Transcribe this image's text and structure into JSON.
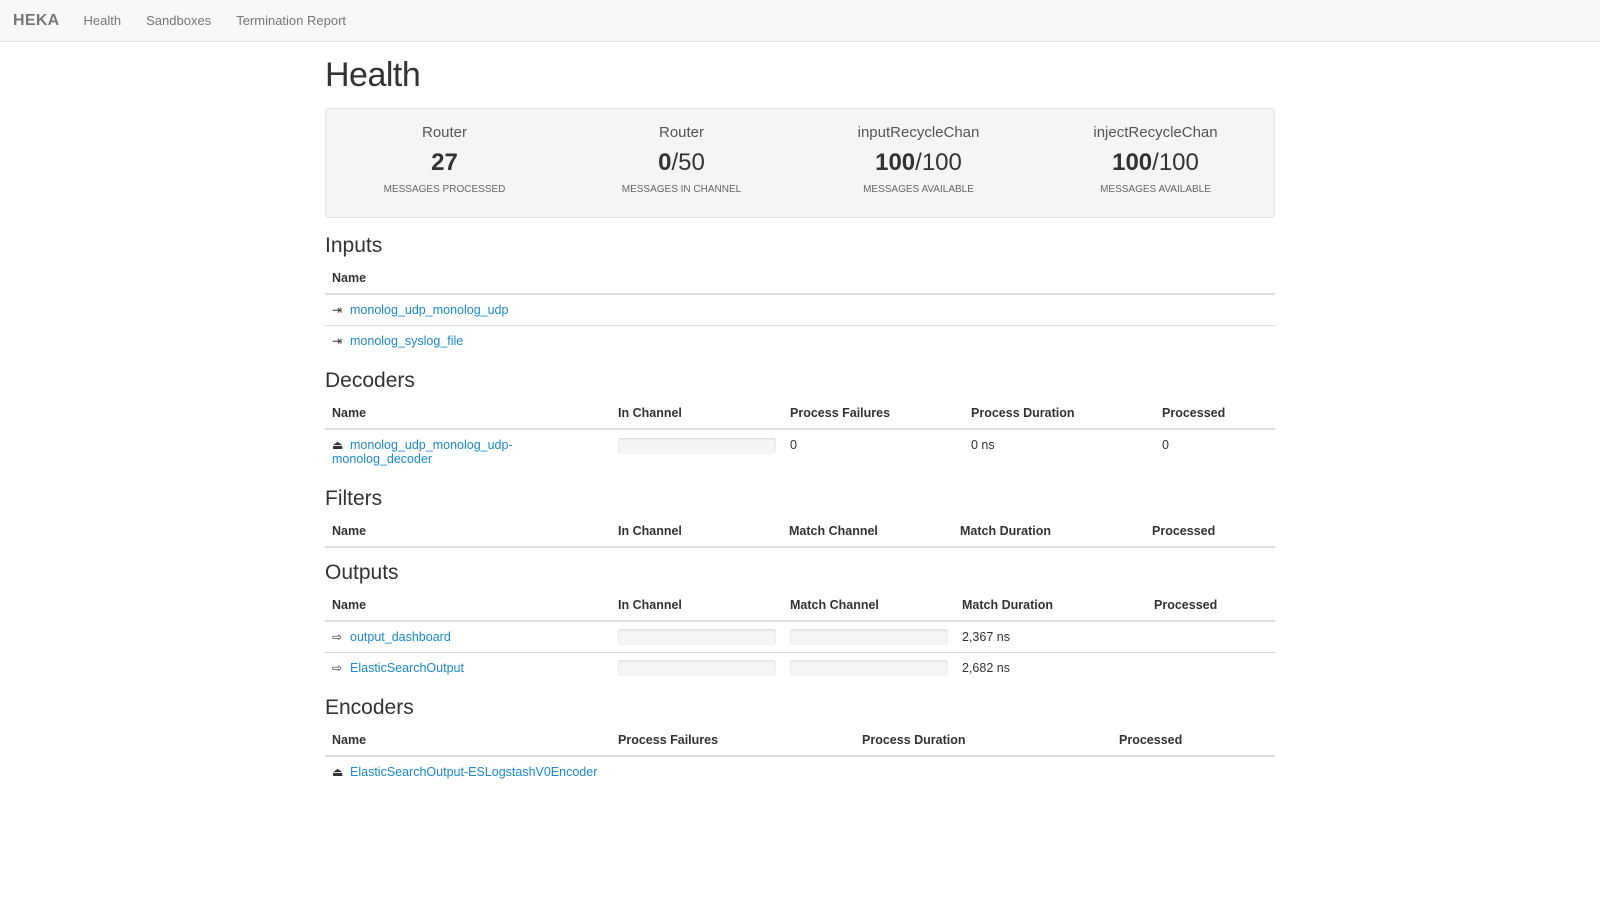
{
  "nav": {
    "brand": "HEKA",
    "links": [
      "Health",
      "Sandboxes",
      "Termination Report"
    ]
  },
  "page_title": "Health",
  "stats": [
    {
      "label": "Router",
      "value": "27",
      "total": "",
      "caption": "MESSAGES PROCESSED"
    },
    {
      "label": "Router",
      "value": "0",
      "total": "/50",
      "caption": "MESSAGES IN CHANNEL"
    },
    {
      "label": "inputRecycleChan",
      "value": "100",
      "total": "/100",
      "caption": "MESSAGES AVAILABLE"
    },
    {
      "label": "injectRecycleChan",
      "value": "100",
      "total": "/100",
      "caption": "MESSAGES AVAILABLE"
    }
  ],
  "inputs": {
    "title": "Inputs",
    "columns": [
      "Name"
    ],
    "rows": [
      {
        "name": "monolog_udp_monolog_udp",
        "icon": "sign-in-icon"
      },
      {
        "name": "monolog_syslog_file",
        "icon": "sign-in-icon"
      }
    ]
  },
  "decoders": {
    "title": "Decoders",
    "columns": [
      "Name",
      "In Channel",
      "Process Failures",
      "Process Duration",
      "Processed"
    ],
    "rows": [
      {
        "name_line1": "monolog_udp_monolog_udp-",
        "name_line2": "monolog_decoder",
        "in_channel_fill": 0,
        "process_failures": "0",
        "process_duration": "0 ns",
        "processed": "0",
        "icon": "decoder-icon"
      }
    ]
  },
  "filters": {
    "title": "Filters",
    "columns": [
      "Name",
      "In Channel",
      "Match Channel",
      "Match Duration",
      "Processed"
    ],
    "rows": []
  },
  "outputs": {
    "title": "Outputs",
    "columns": [
      "Name",
      "In Channel",
      "Match Channel",
      "Match Duration",
      "Processed"
    ],
    "rows": [
      {
        "name": "output_dashboard",
        "in_channel_fill": 0,
        "match_channel_fill": 0,
        "match_duration": "2,367 ns",
        "processed": "",
        "icon": "sign-out-icon"
      },
      {
        "name": "ElasticSearchOutput",
        "in_channel_fill": 0,
        "match_channel_fill": 0,
        "match_duration": "2,682 ns",
        "processed": "",
        "icon": "sign-out-icon"
      }
    ]
  },
  "encoders": {
    "title": "Encoders",
    "columns": [
      "Name",
      "Process Failures",
      "Process Duration",
      "Processed"
    ],
    "rows": [
      {
        "name": "ElasticSearchOutput-ESLogstashV0Encoder",
        "process_failures": "",
        "process_duration": "",
        "processed": "",
        "icon": "encoder-icon"
      }
    ]
  }
}
